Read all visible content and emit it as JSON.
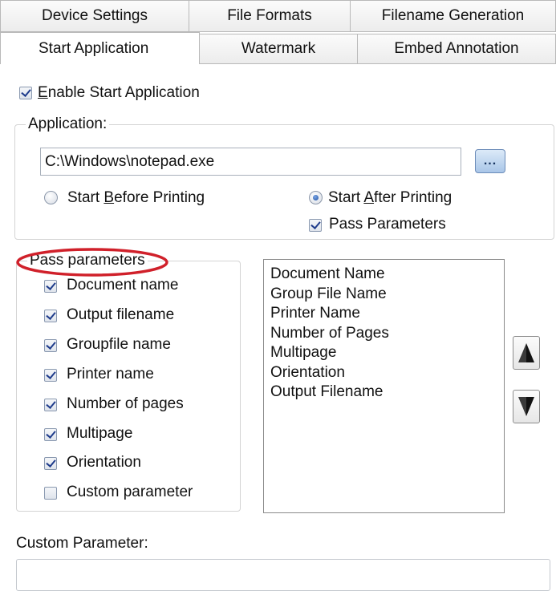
{
  "tabs": {
    "row1": [
      "Device Settings",
      "File Formats",
      "Filename Generation"
    ],
    "row2": [
      "Start Application",
      "Watermark",
      "Embed Annotation"
    ],
    "active": "Start Application"
  },
  "enable": {
    "prefix": "",
    "accel": "E",
    "rest": "nable Start Application",
    "checked": true
  },
  "application": {
    "legend": "Application:",
    "path": "C:\\Windows\\notepad.exe",
    "browse_label": "...",
    "start_before": {
      "prefix": "Start ",
      "accel": "B",
      "rest": "efore Printing",
      "selected": false
    },
    "start_after": {
      "prefix": "Start ",
      "accel": "A",
      "rest": "fter Printing",
      "selected": true
    },
    "pass_parameters": {
      "label": "Pass Parameters",
      "checked": true
    }
  },
  "pass_parameters_group": {
    "legend": "Pass parameters",
    "legend_highlight_color": "#d0202a",
    "items": [
      {
        "label": "Document name",
        "checked": true
      },
      {
        "label": "Output filename",
        "checked": true
      },
      {
        "label": "Groupfile name",
        "checked": true
      },
      {
        "label": "Printer name",
        "checked": true
      },
      {
        "label": "Number of pages",
        "checked": true
      },
      {
        "label": "Multipage",
        "checked": true
      },
      {
        "label": "Orientation",
        "checked": true
      },
      {
        "label": "Custom parameter",
        "checked": false
      }
    ]
  },
  "order_list": [
    "Document Name",
    "Group File Name",
    "Printer Name",
    "Number of Pages",
    "Multipage",
    "Orientation",
    "Output Filename"
  ],
  "move_buttons": {
    "up_icon": "triangle-up-icon",
    "down_icon": "triangle-down-icon"
  },
  "custom_parameter": {
    "label": "Custom Parameter:",
    "value": ""
  }
}
